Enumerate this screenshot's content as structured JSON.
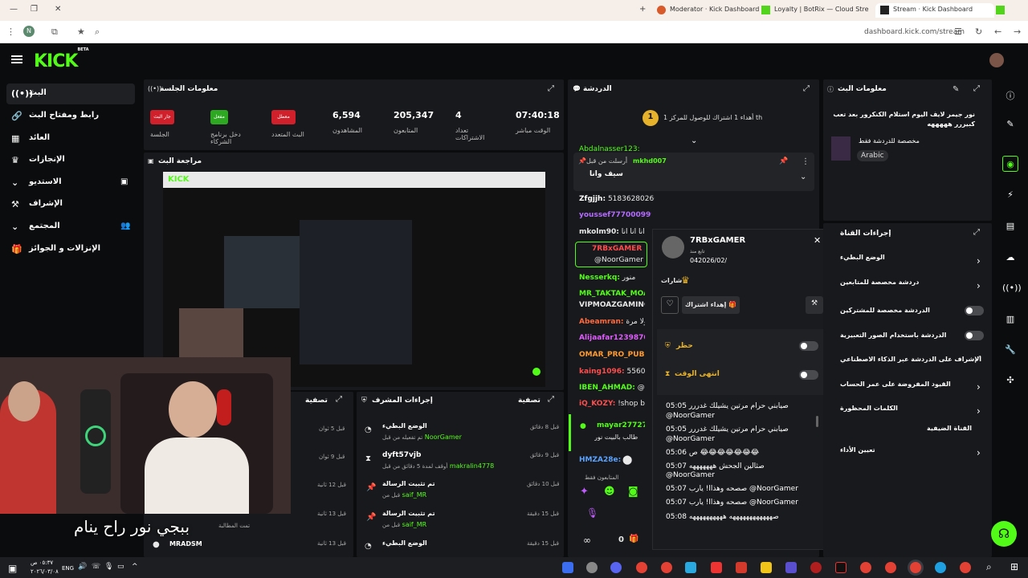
{
  "browser": {
    "tabs": [
      {
        "label": "Moderator · Kick Dashboard"
      },
      {
        "label": "Loyalty | BotRix — Cloud Stream"
      },
      {
        "label": "Stream · Kick Dashboard"
      }
    ],
    "url": "dashboard.kick.com/stream",
    "profile_initial": "N"
  },
  "brand": {
    "logo": "KICK",
    "beta": "BETA"
  },
  "sidebar": {
    "items": [
      {
        "label": "البث",
        "icon": "radio-icon"
      },
      {
        "label": "رابط ومفتاح البث",
        "icon": "link-icon"
      },
      {
        "label": "العائد",
        "icon": "chart-icon"
      },
      {
        "label": "الإنجازات",
        "icon": "trophy-icon"
      },
      {
        "label": "الاستديو",
        "icon": "studio-icon"
      },
      {
        "label": "الإشراف",
        "icon": "hammer-icon"
      },
      {
        "label": "المجتمع",
        "icon": "community-icon"
      },
      {
        "label": "الإنزالات و الجوائز",
        "icon": "gift-icon"
      }
    ]
  },
  "session": {
    "title": "معلومات الجلسة",
    "stats": [
      {
        "value": "07:40:18",
        "label": "الوقت مباشر"
      },
      {
        "value": "4",
        "label": "تعداد الاشتراكات"
      },
      {
        "value": "205,347",
        "label": "المتابعون"
      },
      {
        "value": "6,594",
        "label": "المشاهدون"
      }
    ],
    "badges": [
      {
        "text": "معطل",
        "label": "البث المتعدد"
      },
      {
        "text": "مفعل",
        "label": "دخل برنامج الشركاء"
      },
      {
        "text": "جار البث",
        "label": "الجلسة"
      }
    ]
  },
  "review": {
    "title": "مراجعة البث"
  },
  "subtitle": "ببجي نور راح ينام",
  "activity": {
    "title": "تصفية",
    "label": "تمت المطالبة",
    "user": "MRADSM",
    "times": [
      "قبل 5 ثوان",
      "قبل 9 ثوان",
      "قبل 12 ثانية",
      "قبل 13 ثانية",
      "قبل 13 ثانية"
    ]
  },
  "mod_actions": {
    "title": "إجراءات المشرف",
    "filter": "تصفية",
    "rows": [
      {
        "title": "الوضع البطيء",
        "sub": "تم تفعيله من قبل",
        "user": "NoorGamer",
        "time": "قبل 8 دقائق"
      },
      {
        "title": "dyft57vjb",
        "sub": "أوقف لمدة 5 دقائق من قبل",
        "user": "makralin4778",
        "time": "قبل 9 دقائق"
      },
      {
        "title": "تم تثبيت الرسالة",
        "sub": "قبل من",
        "user": "saif_MR",
        "time": "قبل 10 دقائق"
      },
      {
        "title": "تم تثبيت الرسالة",
        "sub": "قبل من",
        "user": "saif_MR",
        "time": "قبل 15 دقيقة"
      },
      {
        "title": "الوضع البطيء",
        "sub": "",
        "user": "",
        "time": "قبل 15 دقيقة"
      }
    ]
  },
  "chat": {
    "title": "الدردشة",
    "gift_banner": "أهداء 1 اشتراك للوصول للمركز 1 th",
    "gift_rank": "1",
    "pinned": {
      "label": "أرسلت من قبل",
      "user": "mkhd007",
      "text": "سيف وانا"
    },
    "lines": [
      {
        "user": "Abdalnasser123:",
        "color": "#53fc18"
      },
      {
        "user": "Zfgjjh:",
        "text": "51836280266",
        "color": "#fff"
      },
      {
        "user": "youssef777000999:",
        "color": "#b46cff"
      },
      {
        "user": "mkolm90:",
        "text": "انا انا انا",
        "color": "#fff"
      },
      {
        "user": "7RBxGAMER",
        "text": "@NoorGamer",
        "color": "#ff4d4d"
      },
      {
        "user": "Nesserkq:",
        "text": "منور",
        "color": "#53fc18"
      },
      {
        "user": "MR_TAKTAK_MOA",
        "color": "#53fc18"
      },
      {
        "user": "VIPMOAZGAMING1",
        "color": "#fff"
      },
      {
        "user": "Abeamran:",
        "text": "ي ولا مرة",
        "color": "#ff6a3d"
      },
      {
        "user": "Alijaafar1239870:",
        "color": "#e05cff"
      },
      {
        "user": "OMAR_PRO_PUBG",
        "color": "#ff9b2f"
      },
      {
        "user": "kaing1096:",
        "text": "556063",
        "color": "#ff4d4d"
      },
      {
        "user": "IBEN_AHMAD:",
        "text": "@sa",
        "color": "#53fc18"
      },
      {
        "user": "iQ_KOZY:",
        "text": "!shop bu",
        "color": "#ff4d4d"
      },
      {
        "user": "mayar277273",
        "text": "طالب بالبيت نور",
        "color": "#53fc18"
      },
      {
        "user": "HMZA28e:",
        "color": "#5aa2ff"
      }
    ],
    "followers_label": "المتابعون فقط",
    "footer_count": "0"
  },
  "user_card": {
    "username": "7RBxGAMER",
    "follow_label": "تابع منذ",
    "follow_date": "042026/02/",
    "badges_label": "شارات",
    "gift_sub_label": "إهداء اشتراك",
    "ban_label": "حظر",
    "timeout_label": "انتهى الوقت",
    "messages": [
      {
        "text": "صيابني حرام مرتين يشيلك غدررر",
        "time": "05:05",
        "mention": "@NoorGamer"
      },
      {
        "text": "صيابني حرام مرتين يشيلك غدررر",
        "time": "05:05",
        "mention": "@NoorGamer"
      },
      {
        "text": "ص 😂😂😂😂😂😂😂",
        "time": "05:06",
        "mention": ""
      },
      {
        "text": "صثالين الجحش هههههههه",
        "time": "05:07",
        "mention": "@NoorGamer"
      },
      {
        "text": "صصحه وهذاا! يارب",
        "time": "05:07",
        "mention": "@NoorGamer"
      },
      {
        "text": "صصحه وهذاا! يارب",
        "time": "05:07",
        "mention": "@NoorGamer"
      },
      {
        "text": "صههههههههههههه ههههههههههه",
        "time": "05:08",
        "mention": ""
      }
    ]
  },
  "stream_info": {
    "title": "معلومات البث",
    "stream_title": "نور جيمر لايف اليوم استلام الكنكرور بعد تعب كبيررر هههههه",
    "category": "مخصصة للدردشة فقط",
    "language": "Arabic"
  },
  "chat_actions": {
    "title": "إجراءات القناة",
    "items": [
      {
        "label": "الوضع البطيء",
        "type": "chevron"
      },
      {
        "label": "دردشة مخصصة للمتابعين",
        "type": "chevron"
      },
      {
        "label": "الدردشة مخصصة للمشتركين",
        "type": "toggle"
      },
      {
        "label": "الدردشة باستخدام الصور التعبيرية",
        "type": "toggle"
      },
      {
        "label": "الإشراف على الدردشة عبر الذكاء الاصطناعي",
        "type": "link"
      },
      {
        "label": "القيود المفروضة على عمر الحساب",
        "type": "chevron"
      },
      {
        "label": "الكلمات المحظورة",
        "type": "chevron"
      },
      {
        "label": "القناة الضيفية",
        "type": "none"
      },
      {
        "label": "تعيين الأداء",
        "type": "chevron"
      }
    ]
  },
  "taskbar": {
    "time": "٠٥:٣٧ ص",
    "date": "٢٠٢٦/٠٣/٠٨",
    "lang": "ENG"
  }
}
